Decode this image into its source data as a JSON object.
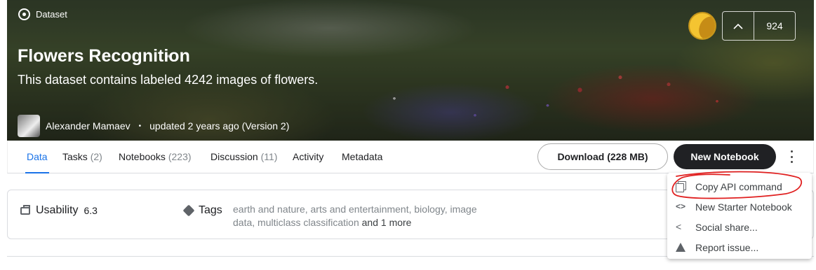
{
  "header": {
    "badge": "Dataset",
    "title": "Flowers Recognition",
    "subtitle": "This dataset contains labeled 4242 images of flowers.",
    "author": "Alexander Mamaev",
    "updated": "updated 2 years ago (Version 2)",
    "separator": "•",
    "medal_color": "#f4c431",
    "vote_count": "924"
  },
  "tabs": [
    {
      "label": "Data",
      "count": ""
    },
    {
      "label": "Tasks",
      "count": "(2)"
    },
    {
      "label": "Notebooks",
      "count": "(223)"
    },
    {
      "label": "Discussion",
      "count": "(11)"
    },
    {
      "label": "Activity",
      "count": ""
    },
    {
      "label": "Metadata",
      "count": ""
    }
  ],
  "actions": {
    "download": "Download (228 MB)",
    "new_notebook": "New Notebook"
  },
  "info": {
    "usability_label": "Usability",
    "usability_score": "6.3",
    "tags_label": "Tags",
    "tags_text": "earth and nature, arts and entertainment, biology, image data, multiclass classification",
    "tags_more": "and 1 more"
  },
  "menu": {
    "items": [
      {
        "label": "Copy API command",
        "icon": "copy-icon"
      },
      {
        "label": "New Starter Notebook",
        "icon": "code-icon"
      },
      {
        "label": "Social share...",
        "icon": "share-icon"
      },
      {
        "label": "Report issue...",
        "icon": "warning-icon"
      }
    ]
  },
  "colors": {
    "accent": "#1a73e8",
    "annotation_circle": "#e02020"
  }
}
